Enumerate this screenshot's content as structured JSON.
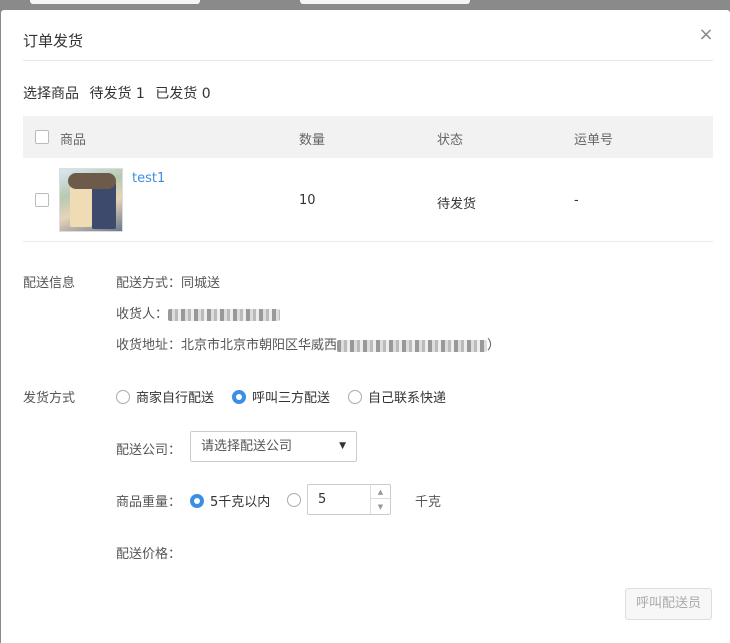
{
  "dialog": {
    "title": "订单发货",
    "close_glyph": "×"
  },
  "goods_section": {
    "label": "选择商品",
    "pending": "待发货 1",
    "shipped": "已发货 0"
  },
  "table": {
    "headers": [
      "商品",
      "数量",
      "状态",
      "运单号"
    ],
    "rows": [
      {
        "name": "test1",
        "quantity": "10",
        "status": "待发货",
        "tracking": "-"
      }
    ]
  },
  "delivery_info": {
    "label": "配送信息",
    "method_label": "配送方式：",
    "method_value": "同城送",
    "receiver_label": "收货人：",
    "address_label": "收货地址：",
    "address_value": "北京市北京市朝阳区华威西",
    "address_tail": "）"
  },
  "shipping_method": {
    "label": "发货方式",
    "options": [
      "商家自行配送",
      "呼叫三方配送",
      "自己联系快递"
    ],
    "selected_index": 1
  },
  "delivery_company": {
    "label": "配送公司：",
    "placeholder": "请选择配送公司",
    "caret": "▼"
  },
  "weight": {
    "label": "商品重量：",
    "option_preset": "5千克以内",
    "custom_value": "5",
    "unit": "千克"
  },
  "price": {
    "label": "配送价格："
  },
  "actions": {
    "call_courier": "呼叫配送员"
  },
  "icons": [
    "close-icon",
    "chevron-up-icon",
    "chevron-down-icon",
    "dropdown-caret-icon"
  ]
}
